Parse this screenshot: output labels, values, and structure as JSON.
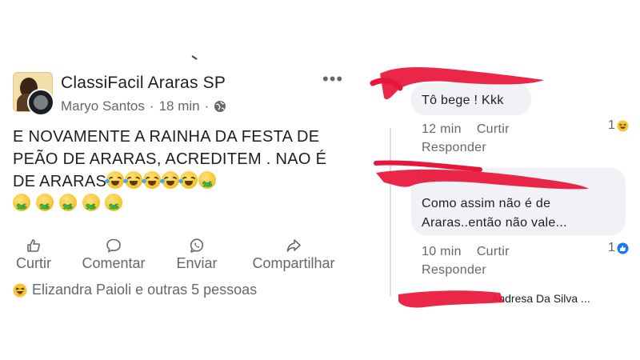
{
  "post": {
    "group_name": "ClassiFacil Araras SP",
    "author": "Maryo Santos",
    "separator": "·",
    "time": "18 min",
    "text_main": "E NOVAMENTE A RAINHA DA FESTA DE PEÃO DE ARARAS, ACREDITEM . NAO É DE ARARAS",
    "actions": [
      "Curtir",
      "Comentar",
      "Enviar",
      "Compartilhar"
    ],
    "reactions_text": "Elizandra Paioli e outras 5 pessoas"
  },
  "comments": [
    {
      "text": "Tô bege ! Kkk",
      "time": "12 min",
      "like_label": "Curtir",
      "reply_label": "Responder",
      "reaction_count": "1"
    },
    {
      "text": "Como assim não é de Araras..então não vale...",
      "time": "10 min",
      "like_label": "Curtir",
      "reply_label": "Responder",
      "reaction_count": "1"
    },
    {
      "text": "Andresa Da Silva ..."
    }
  ],
  "icons": {
    "more": "more-dots-icon",
    "globe": "globe-icon",
    "like": "thumbs-up-icon",
    "comment": "comment-icon",
    "send": "whatsapp-icon",
    "share": "share-icon",
    "haha": "laughing-emoji",
    "like_reaction": "like-reaction-icon"
  },
  "colors": {
    "secondary_text": "#65676b",
    "bubble": "#f0f2f5",
    "like_blue": "#1877f2",
    "redaction": "#e8173a"
  }
}
